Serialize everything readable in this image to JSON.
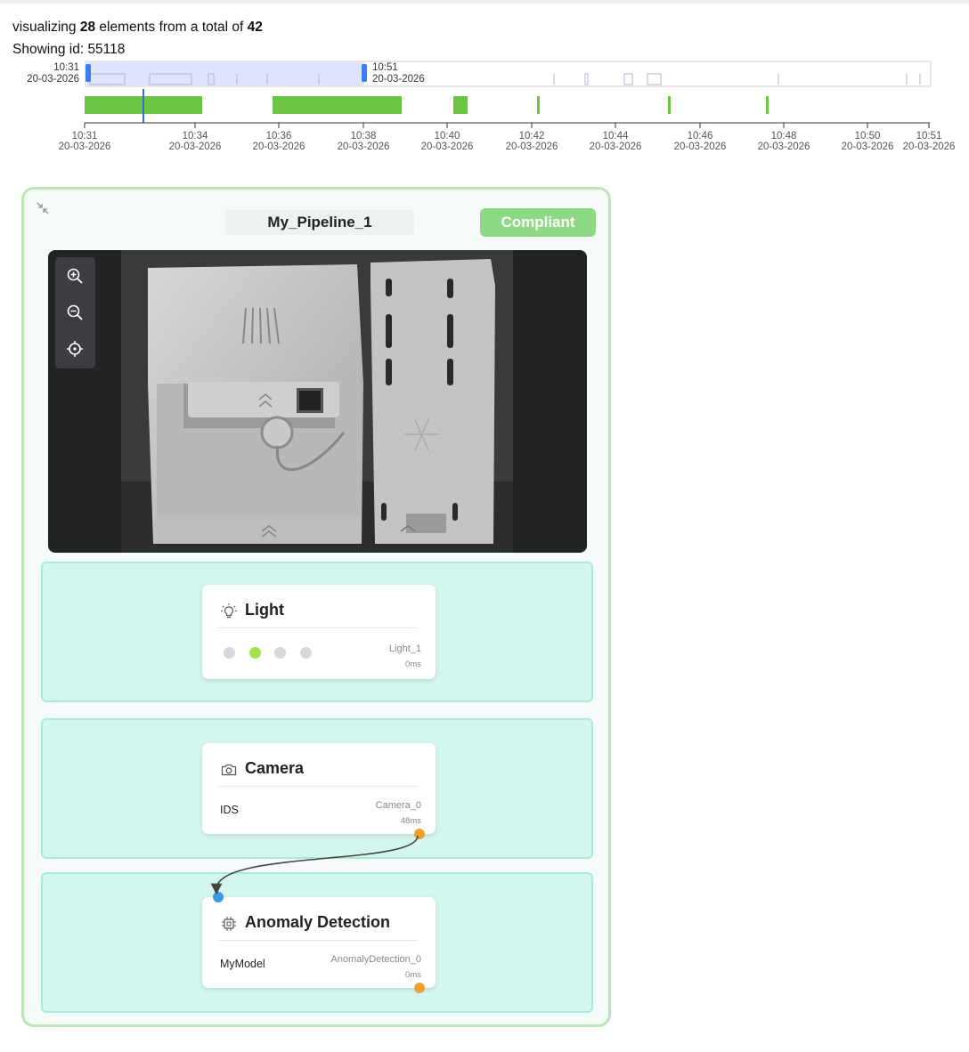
{
  "header": {
    "prefix": "visualizing",
    "visualized_count": "28",
    "middle": "elements from a total of",
    "total_count": "42",
    "showing_label": "Showing id: 55118"
  },
  "brush": {
    "start_time": "10:31",
    "start_date": "20-03-2026",
    "end_time": "10:51",
    "end_date": "20-03-2026"
  },
  "timeline": {
    "ticks": [
      {
        "time": "10:31",
        "date": "20-03-2026"
      },
      {
        "time": "10:34",
        "date": "20-03-2026"
      },
      {
        "time": "10:36",
        "date": "20-03-2026"
      },
      {
        "time": "10:38",
        "date": "20-03-2026"
      },
      {
        "time": "10:40",
        "date": "20-03-2026"
      },
      {
        "time": "10:42",
        "date": "20-03-2026"
      },
      {
        "time": "10:44",
        "date": "20-03-2026"
      },
      {
        "time": "10:46",
        "date": "20-03-2026"
      },
      {
        "time": "10:48",
        "date": "20-03-2026"
      },
      {
        "time": "10:50",
        "date": "20-03-2026"
      },
      {
        "time": "10:51",
        "date": "20-03-2026"
      }
    ],
    "bar_color": "#6cc644",
    "cursor_color": "#2f6fd6"
  },
  "pipeline": {
    "title": "My_Pipeline_1",
    "status": "Compliant",
    "status_color": "#8ed983",
    "nodes": {
      "light": {
        "title": "Light",
        "id": "Light_1",
        "time": "0ms",
        "active_dot": 1,
        "dot_count": 4
      },
      "camera": {
        "title": "Camera",
        "left": "IDS",
        "id": "Camera_0",
        "time": "48ms"
      },
      "model": {
        "title": "Anomaly Detection",
        "left": "MyModel",
        "id": "AnomalyDetection_0",
        "time": "0ms"
      }
    },
    "port_colors": {
      "output": "#f0a030",
      "input": "#3a9be0"
    }
  },
  "icons": {
    "collapse": "collapse-icon",
    "zoom_in": "zoom-in-icon",
    "zoom_out": "zoom-out-icon",
    "recenter": "recenter-icon",
    "light": "lightbulb-icon",
    "camera": "camera-icon",
    "model": "chip-icon"
  }
}
